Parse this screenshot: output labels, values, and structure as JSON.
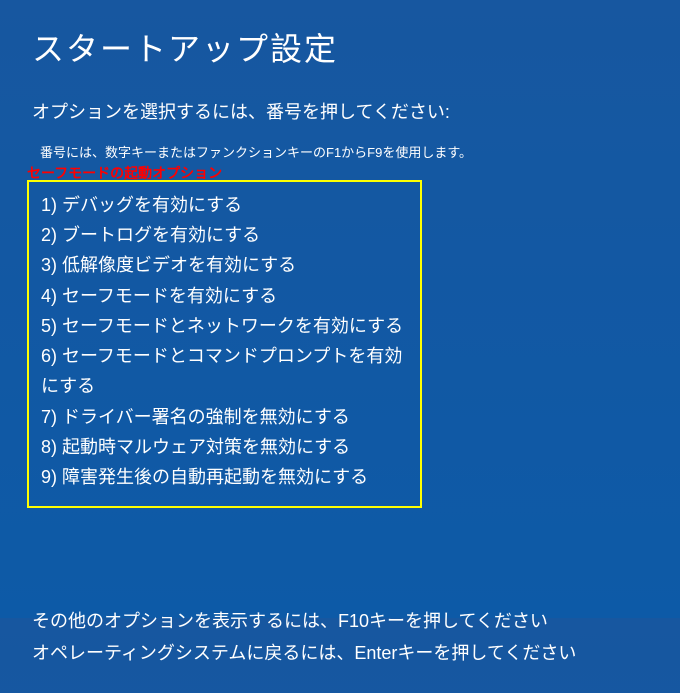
{
  "title": "スタートアップ設定",
  "instruction": "オプションを選択するには、番号を押してください:",
  "sub_instruction": "番号には、数字キーまたはファンクションキーのF1からF9を使用します。",
  "annotation_label": "セーフモードの起動オプション",
  "options": [
    "1) デバッグを有効にする",
    "2) ブートログを有効にする",
    "3) 低解像度ビデオを有効にする",
    "4) セーフモードを有効にする",
    "5) セーフモードとネットワークを有効にする",
    "6) セーフモードとコマンドプロンプトを有効にする",
    "7) ドライバー署名の強制を無効にする",
    "8) 起動時マルウェア対策を無効にする",
    "9) 障害発生後の自動再起動を無効にする"
  ],
  "footer_line1": "その他のオプションを表示するには、F10キーを押してください",
  "footer_line2": "オペレーティングシステムに戻るには、Enterキーを押してください"
}
